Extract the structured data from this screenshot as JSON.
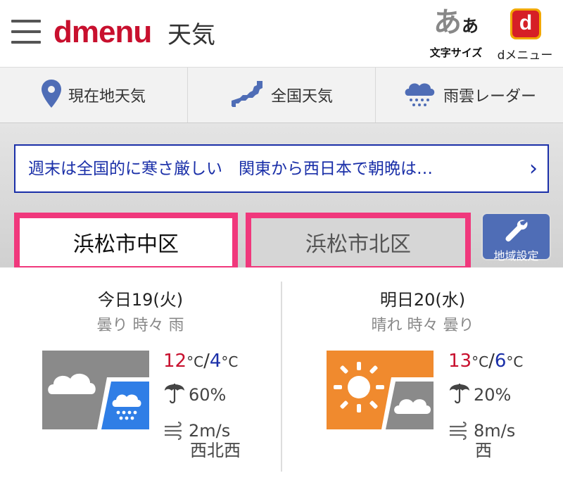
{
  "header": {
    "logo": "dmenu",
    "title": "天気",
    "font_size_glyph_big": "あ",
    "font_size_glyph_small": "あ",
    "font_size_label": "文字サイズ",
    "dmenu_icon_letter": "d",
    "dmenu_label": "dメニュー"
  },
  "nav": {
    "items": [
      {
        "label": "現在地天気",
        "icon": "location-pin-icon"
      },
      {
        "label": "全国天気",
        "icon": "japan-map-icon"
      },
      {
        "label": "雨雲レーダー",
        "icon": "rain-cloud-icon"
      }
    ]
  },
  "news": {
    "text": "週末は全国的に寒さ厳しい　関東から西日本で朝晩は…",
    "chevron": "›"
  },
  "tabs": [
    {
      "label": "浜松市中区",
      "selected": true
    },
    {
      "label": "浜松市北区",
      "selected": false
    }
  ],
  "settings": {
    "label": "地域設定",
    "icon": "wrench-icon"
  },
  "forecast": [
    {
      "date_label": "今日",
      "date": "19(火)",
      "description": "曇り 時々 雨",
      "icon": "cloudy-then-rain-icon",
      "high": "12",
      "low": "4",
      "unit": "°C",
      "separator": "/",
      "precip": "60%",
      "wind_speed": "2m/s",
      "wind_dir": "西北西"
    },
    {
      "date_label": "明日",
      "date": "20(水)",
      "description": "晴れ 時々 曇り",
      "icon": "sunny-then-cloudy-icon",
      "high": "13",
      "low": "6",
      "unit": "°C",
      "separator": "/",
      "precip": "20%",
      "wind_speed": "8m/s",
      "wind_dir": "西"
    }
  ],
  "colors": {
    "brand_red": "#c8102e",
    "high_temp": "#c8102e",
    "low_temp": "#1a2fa8",
    "news_border": "#1a2fa8",
    "tab_highlight": "#f0387c",
    "settings_bg": "#4f6db6",
    "sunny_bg": "#f08a2e",
    "rain_bg": "#2f7ee6",
    "cloud_bg": "#8a8a8a"
  }
}
